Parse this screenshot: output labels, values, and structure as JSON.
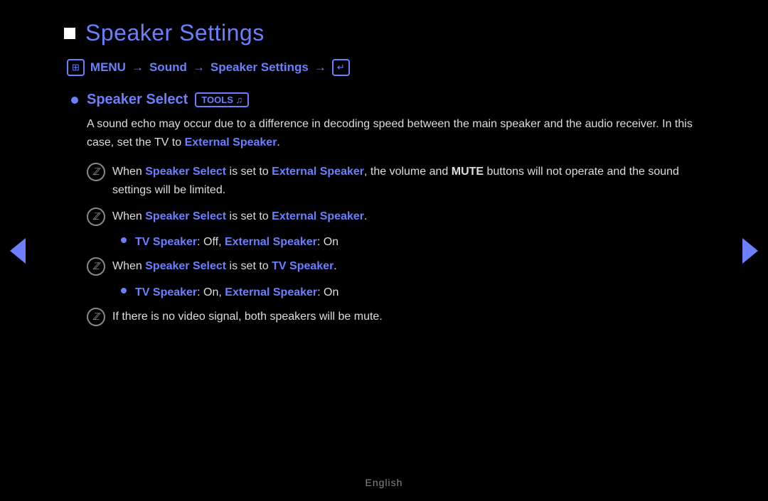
{
  "page": {
    "title": "Speaker Settings",
    "menu_path": {
      "menu_icon_label": "m",
      "menu_label": "MENU",
      "arrow1": "→",
      "sound": "Sound",
      "arrow2": "→",
      "speaker_settings": "Speaker Settings",
      "arrow3": "→",
      "enter_label": "ENTER"
    },
    "speaker_select": {
      "label": "Speaker Select",
      "tools_badge": "TOOLS ♫",
      "description": "A sound echo may occur due to a difference in decoding speed between the main speaker and the audio receiver. In this case, set the TV to ",
      "description_accent": "External Speaker",
      "description_end": "."
    },
    "notes": [
      {
        "id": "note1",
        "text_parts": [
          {
            "text": "When ",
            "accent": false
          },
          {
            "text": "Speaker Select",
            "accent": true
          },
          {
            "text": " is set to ",
            "accent": false
          },
          {
            "text": "External Speaker",
            "accent": true
          },
          {
            "text": ", the volume and ",
            "accent": false
          },
          {
            "text": "MUTE",
            "accent": false,
            "bold": true
          },
          {
            "text": " buttons will not operate and the sound settings will be limited.",
            "accent": false
          }
        ]
      },
      {
        "id": "note2",
        "text_parts": [
          {
            "text": "When ",
            "accent": false
          },
          {
            "text": "Speaker Select",
            "accent": true
          },
          {
            "text": " is set to ",
            "accent": false
          },
          {
            "text": "External Speaker",
            "accent": true
          },
          {
            "text": ".",
            "accent": false
          }
        ],
        "sub_bullets": [
          {
            "parts": [
              {
                "text": "TV Speaker",
                "accent": true
              },
              {
                "text": ": Off, ",
                "accent": false
              },
              {
                "text": "External Speaker",
                "accent": true
              },
              {
                "text": ": On",
                "accent": false
              }
            ]
          }
        ]
      },
      {
        "id": "note3",
        "text_parts": [
          {
            "text": "When ",
            "accent": false
          },
          {
            "text": "Speaker Select",
            "accent": true
          },
          {
            "text": " is set to ",
            "accent": false
          },
          {
            "text": "TV Speaker",
            "accent": true
          },
          {
            "text": ".",
            "accent": false
          }
        ],
        "sub_bullets": [
          {
            "parts": [
              {
                "text": "TV Speaker",
                "accent": true
              },
              {
                "text": ": On, ",
                "accent": false
              },
              {
                "text": "External Speaker",
                "accent": true
              },
              {
                "text": ": On",
                "accent": false
              }
            ]
          }
        ]
      },
      {
        "id": "note4",
        "text_parts": [
          {
            "text": "If there is no video signal, both speakers will be mute.",
            "accent": false
          }
        ]
      }
    ],
    "footer": "English",
    "nav": {
      "left_arrow": "◄",
      "right_arrow": "►"
    }
  }
}
